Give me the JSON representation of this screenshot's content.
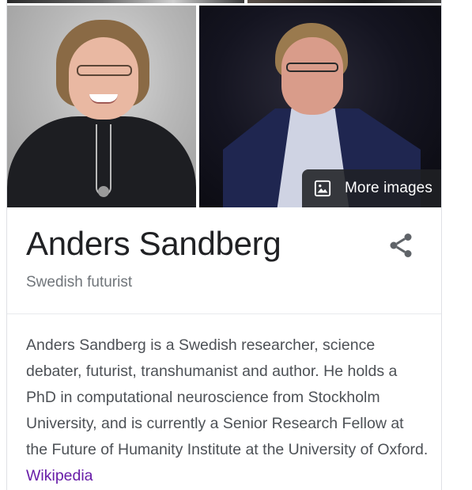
{
  "images": {
    "more_images_label": "More images"
  },
  "entity": {
    "name": "Anders Sandberg",
    "subtitle": "Swedish futurist"
  },
  "description": {
    "text": "Anders Sandberg is a Swedish researcher, science debater, futurist, transhumanist and author. He holds a PhD in computational neuroscience from Stockholm University, and is currently a Senior Research Fellow at the Future of Humanity Institute at the University of Oxford.",
    "source_link": "Wikipedia"
  },
  "icons": {
    "more_images": "image-icon",
    "share": "share-icon"
  },
  "colors": {
    "title": "#202124",
    "subtitle": "#70757a",
    "body_text": "#4d5156",
    "link": "#681da8",
    "overlay": "#202124"
  }
}
